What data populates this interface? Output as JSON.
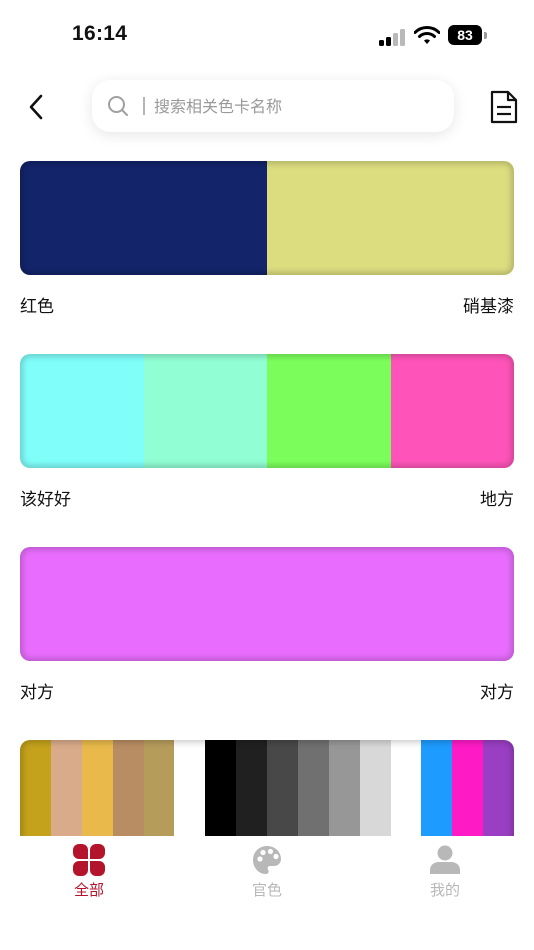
{
  "status_bar": {
    "time": "16:14",
    "battery": "83"
  },
  "search": {
    "placeholder": "搜索相关色卡名称"
  },
  "palettes": [
    {
      "colors": [
        "#13246a",
        "#dcdd7f"
      ],
      "left_label": "红色",
      "right_label": "硝基漆"
    },
    {
      "colors": [
        "#80fefa",
        "#91fed4",
        "#7bfe5c",
        "#fe54b9"
      ],
      "left_label": "该好好",
      "right_label": "地方"
    },
    {
      "colors": [
        "#e86dfe"
      ],
      "left_label": "对方",
      "right_label": "对方"
    },
    {
      "colors": [
        "#c4a21b",
        "#d9ab8a",
        "#e9b94b",
        "#b98d63",
        "#b69c5b",
        "#ffffff",
        "#000000",
        "#202020",
        "#484848",
        "#707070",
        "#979797",
        "#d8d8d8",
        "#ffffff",
        "#1e9bfe",
        "#fe1bc5",
        "#9a3fc3"
      ]
    }
  ],
  "tabs": [
    {
      "label": "全部",
      "icon": "clover-grid-icon",
      "active": true
    },
    {
      "label": "官色",
      "icon": "palette-icon",
      "active": false
    },
    {
      "label": "我的",
      "icon": "user-icon",
      "active": false
    }
  ],
  "colors": {
    "accent": "#b3132b",
    "inactive": "#b8b8b8"
  }
}
